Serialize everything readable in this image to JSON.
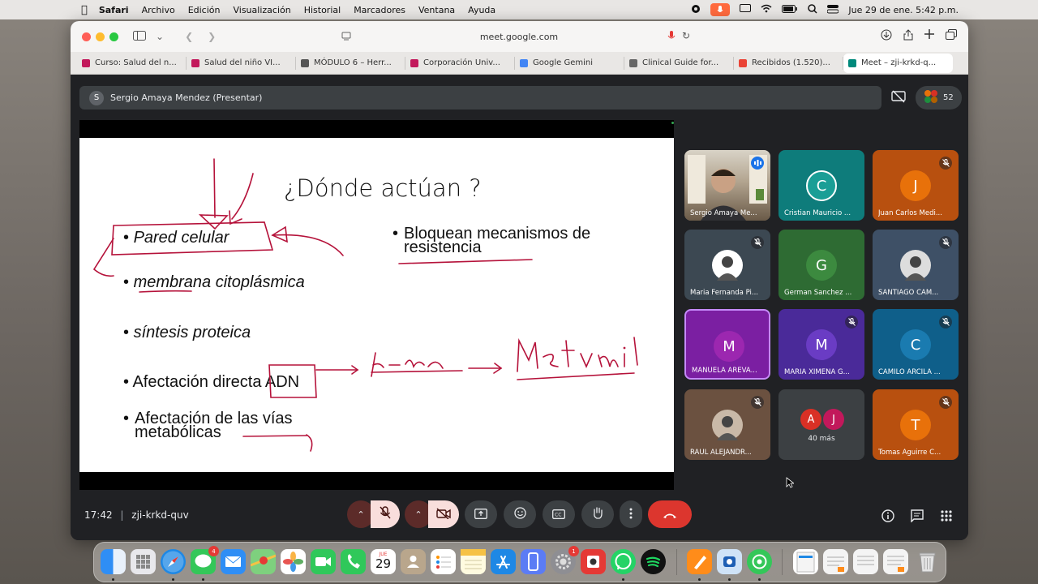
{
  "menubar": {
    "app": "Safari",
    "items": [
      "Archivo",
      "Edición",
      "Visualización",
      "Historial",
      "Marcadores",
      "Ventana",
      "Ayuda"
    ],
    "clock": "Jue 29 de ene.  5:42 p.m."
  },
  "browser": {
    "url": "meet.google.com",
    "tabs": [
      {
        "label": "Curso: Salud del n...",
        "icon": "tab-favicon-icon",
        "color": "#c2185b"
      },
      {
        "label": "Salud del niño VI...",
        "icon": "tab-favicon-icon",
        "color": "#c2185b"
      },
      {
        "label": "MÓDULO 6 – Herr...",
        "icon": "tab-favicon-icon",
        "color": "#555555"
      },
      {
        "label": "Corporación Univ...",
        "icon": "tab-favicon-icon",
        "color": "#c2185b"
      },
      {
        "label": "Google Gemini",
        "icon": "gemini-icon",
        "color": "#4285f4"
      },
      {
        "label": "Clinical Guide for...",
        "icon": "tab-favicon-icon",
        "color": "#666666"
      },
      {
        "label": "Recibidos (1.520)...",
        "icon": "gmail-icon",
        "color": "#ea4335"
      },
      {
        "label": "Meet – zji-krkd-q...",
        "icon": "meet-icon",
        "color": "#00897b"
      }
    ]
  },
  "meet": {
    "presenter_initial": "S",
    "presenter_label": "Sergio Amaya Mendez (Presentar)",
    "participant_count": "52",
    "time": "17:42",
    "meeting_code": "zji-krkd-quv",
    "more_label": "40 más",
    "more_initials": [
      "A",
      "J"
    ]
  },
  "slide": {
    "title": "¿Dónde actúan ?",
    "bullets": [
      "Pared celular",
      "membrana citoplásmica",
      "síntesis proteica",
      "Afectación directa ADN",
      "Afectación de las vías metabólicas",
      "Bloquean mecanismos de resistencia"
    ]
  },
  "tiles": [
    {
      "name": "Sergio Amaya Me...",
      "initial": "",
      "bg": "#8a7a66",
      "avatar": "",
      "muted": false,
      "speaking": true
    },
    {
      "name": "Cristian Mauricio ...",
      "initial": "C",
      "bg": "#0e7c7b",
      "avatar": "#1a9e96",
      "muted": false,
      "speaking": false
    },
    {
      "name": "Juan Carlos Medi...",
      "initial": "J",
      "bg": "#b8500f",
      "avatar": "#e8710a",
      "muted": true,
      "speaking": false
    },
    {
      "name": "Maria Fernanda Pi...",
      "initial": "",
      "bg": "#3c4852",
      "avatar": "#ffffff",
      "muted": true,
      "speaking": false
    },
    {
      "name": "German Sanchez ...",
      "initial": "G",
      "bg": "#2e6b33",
      "avatar": "#3c8a3f",
      "muted": false,
      "speaking": false
    },
    {
      "name": "SANTIAGO CAM...",
      "initial": "",
      "bg": "#3e5066",
      "avatar": "#dddddd",
      "muted": true,
      "speaking": false
    },
    {
      "name": "MANUELA ARÉVA...",
      "initial": "M",
      "bg": "#7b1fa2",
      "avatar": "#9c27b0",
      "muted": false,
      "speaking": false
    },
    {
      "name": "MARIA XIMENA G...",
      "initial": "M",
      "bg": "#4a2a99",
      "avatar": "#6a3cc4",
      "muted": true,
      "speaking": false
    },
    {
      "name": "CAMILO ARCILA ...",
      "initial": "C",
      "bg": "#0f5f8a",
      "avatar": "#1a7bb0",
      "muted": true,
      "speaking": false
    },
    {
      "name": "RAUL ALEJANDR...",
      "initial": "",
      "bg": "#6b5140",
      "avatar": "#c9b9a8",
      "muted": true,
      "speaking": false
    },
    {
      "name": "",
      "initial": "",
      "bg": "#3c4043",
      "avatar": "",
      "muted": false,
      "speaking": false
    },
    {
      "name": "Tomas Aguirre C...",
      "initial": "T",
      "bg": "#b8500f",
      "avatar": "#e8710a",
      "muted": true,
      "speaking": false
    }
  ],
  "dock": {
    "messages_badge": "4",
    "settings_badge": "1",
    "calendar_day": "29",
    "calendar_month": "JUE"
  },
  "colors": {
    "accent_red": "#ea4335",
    "ink": "#b5123a",
    "meet_bg": "#202124"
  }
}
